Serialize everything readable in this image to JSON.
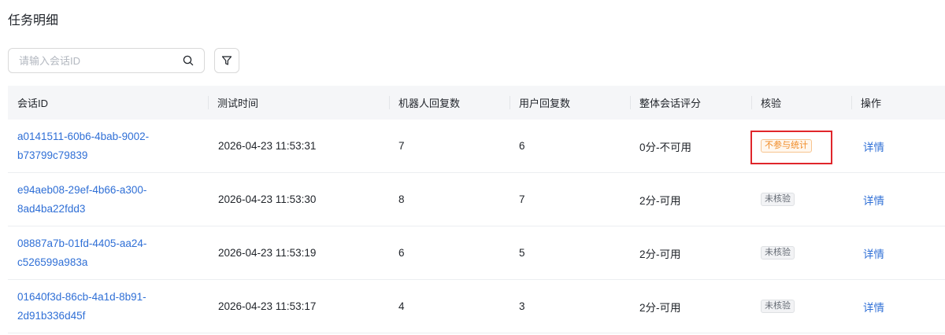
{
  "page": {
    "title": "任务明细"
  },
  "search": {
    "placeholder": "请输入会话ID",
    "value": ""
  },
  "icons": {
    "search": "search-icon",
    "filter": "filter-icon"
  },
  "colors": {
    "link": "#2f6fd6",
    "tag_orange": "#f08a24",
    "highlight": "#e0262b"
  },
  "table": {
    "headers": [
      "会话ID",
      "测试时间",
      "机器人回复数",
      "用户回复数",
      "整体会话评分",
      "核验",
      "操作"
    ],
    "rows": [
      {
        "id_line1": "a0141511-60b6-4bab-9002-",
        "id_line2": "b73799c79839",
        "time": "2026-04-23 11:53:31",
        "bot_replies": "7",
        "user_replies": "6",
        "score": "0分-不可用",
        "verify": "不参与统计",
        "verify_style": "orange",
        "action": "详情"
      },
      {
        "id_line1": "e94aeb08-29ef-4b66-a300-",
        "id_line2": "8ad4ba22fdd3",
        "time": "2026-04-23 11:53:30",
        "bot_replies": "8",
        "user_replies": "7",
        "score": "2分-可用",
        "verify": "未核验",
        "verify_style": "gray",
        "action": "详情"
      },
      {
        "id_line1": "08887a7b-01fd-4405-aa24-",
        "id_line2": "c526599a983a",
        "time": "2026-04-23 11:53:19",
        "bot_replies": "6",
        "user_replies": "5",
        "score": "2分-可用",
        "verify": "未核验",
        "verify_style": "gray",
        "action": "详情"
      },
      {
        "id_line1": "01640f3d-86cb-4a1d-8b91-",
        "id_line2": "2d91b336d45f",
        "time": "2026-04-23 11:53:17",
        "bot_replies": "4",
        "user_replies": "3",
        "score": "2分-可用",
        "verify": "未核验",
        "verify_style": "gray",
        "action": "详情"
      }
    ]
  }
}
